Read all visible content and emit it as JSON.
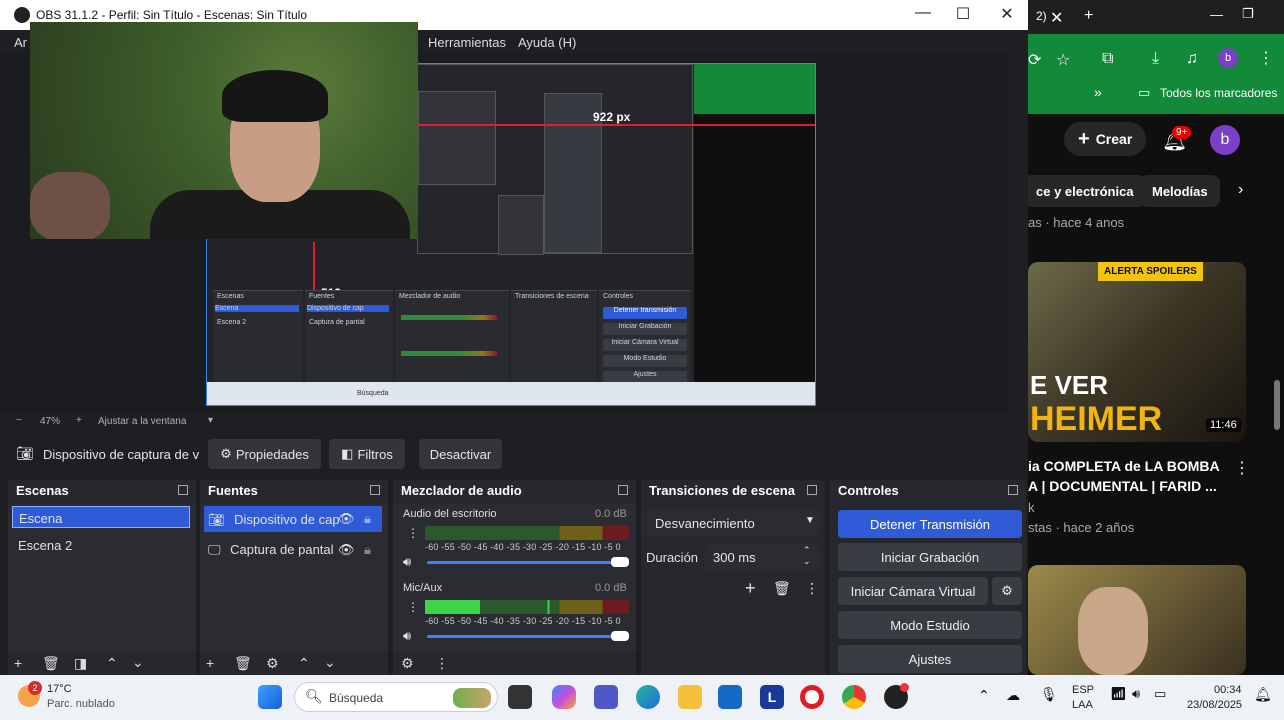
{
  "obs": {
    "window_title": "OBS 31.1.2 - Perfil: Sin Título - Escenas: Sin Título",
    "menu": [
      "Ar",
      "Herramientas",
      "Ayuda (H)"
    ],
    "preview": {
      "measure_h": "922 px",
      "measure_v": "513 px",
      "mini_panels": [
        "Escenas",
        "Fuentes",
        "Mezclador de audio",
        "Transiciones de escena",
        "Controles"
      ],
      "mini_buttons": [
        "Detener transmisión",
        "Iniciar Grabación",
        "Iniciar Cámara Virtual",
        "Modo Estudio",
        "Ajustes"
      ],
      "mini_source_items": [
        "Dispositivo de cap",
        "Captura de pantal"
      ],
      "mini_scene_items": [
        "Escena",
        "Escena 2"
      ],
      "mini_search": "Búsqueda"
    },
    "zoom": {
      "minus": "−",
      "value": "47%",
      "plus": "+",
      "fit_label": "Ajustar a la ventana"
    },
    "source_bar": {
      "source_name": "Dispositivo de captura de v",
      "properties": "Propiedades",
      "filters": "Filtros",
      "deactivate": "Desactivar"
    },
    "scenes": {
      "header": "Escenas",
      "items": [
        "Escena",
        "Escena 2"
      ]
    },
    "sources": {
      "header": "Fuentes",
      "items": [
        "Dispositivo de cap",
        "Captura de pantal"
      ]
    },
    "mixer": {
      "header": "Mezclador de audio",
      "channels": [
        {
          "name": "Audio del escritorio",
          "db": "0.0 dB",
          "level": 0.0
        },
        {
          "name": "Mic/Aux",
          "db": "0.0 dB",
          "level": 0.33
        }
      ],
      "scale": "-60 -55 -50 -45 -40 -35 -30 -25 -20 -15 -10  -5  0"
    },
    "transitions": {
      "header": "Transiciones de escena",
      "selected": "Desvanecimiento",
      "duration_label": "Duración",
      "duration_value": "300 ms"
    },
    "controls": {
      "header": "Controles",
      "buttons": [
        "Detener Transmisión",
        "Iniciar Grabación",
        "Iniciar Cámara Virtual",
        "Modo Estudio",
        "Ajustes"
      ]
    }
  },
  "browser": {
    "tab_suffix": "2)",
    "bookmarks_label": "Todos los marcadores",
    "create_label": "Crear",
    "notif_count": "9+",
    "avatar_letter": "b",
    "chips": [
      "ce y electrónica",
      "Melodías"
    ],
    "meta_top": "as · hace 4 anos",
    "thumb_badge": "ALERTA SPOILERS",
    "thumb_text_top": "E VER",
    "thumb_text_bottom": "HEIMER",
    "duration": "11:46",
    "video_title_1": "ia COMPLETA de LA BOMBA",
    "video_title_2": "A | DOCUMENTAL | FARID ...",
    "channel_frag": "k",
    "meta_2": "stas · hace 2 años"
  },
  "taskbar": {
    "weather_temp": "17°C",
    "weather_desc": "Parc. nublado",
    "weather_badge": "2",
    "search_label": "Búsqueda",
    "lang_1": "ESP",
    "lang_2": "LAA",
    "time": "00:34",
    "date": "23/08/2025"
  },
  "colors": {
    "obs_bg": "#1e1f22",
    "dock_bg": "#27282d",
    "accent_blue": "#2f5cd6",
    "browser_green": "#138a3a",
    "measure_red": "#e21d2a"
  }
}
